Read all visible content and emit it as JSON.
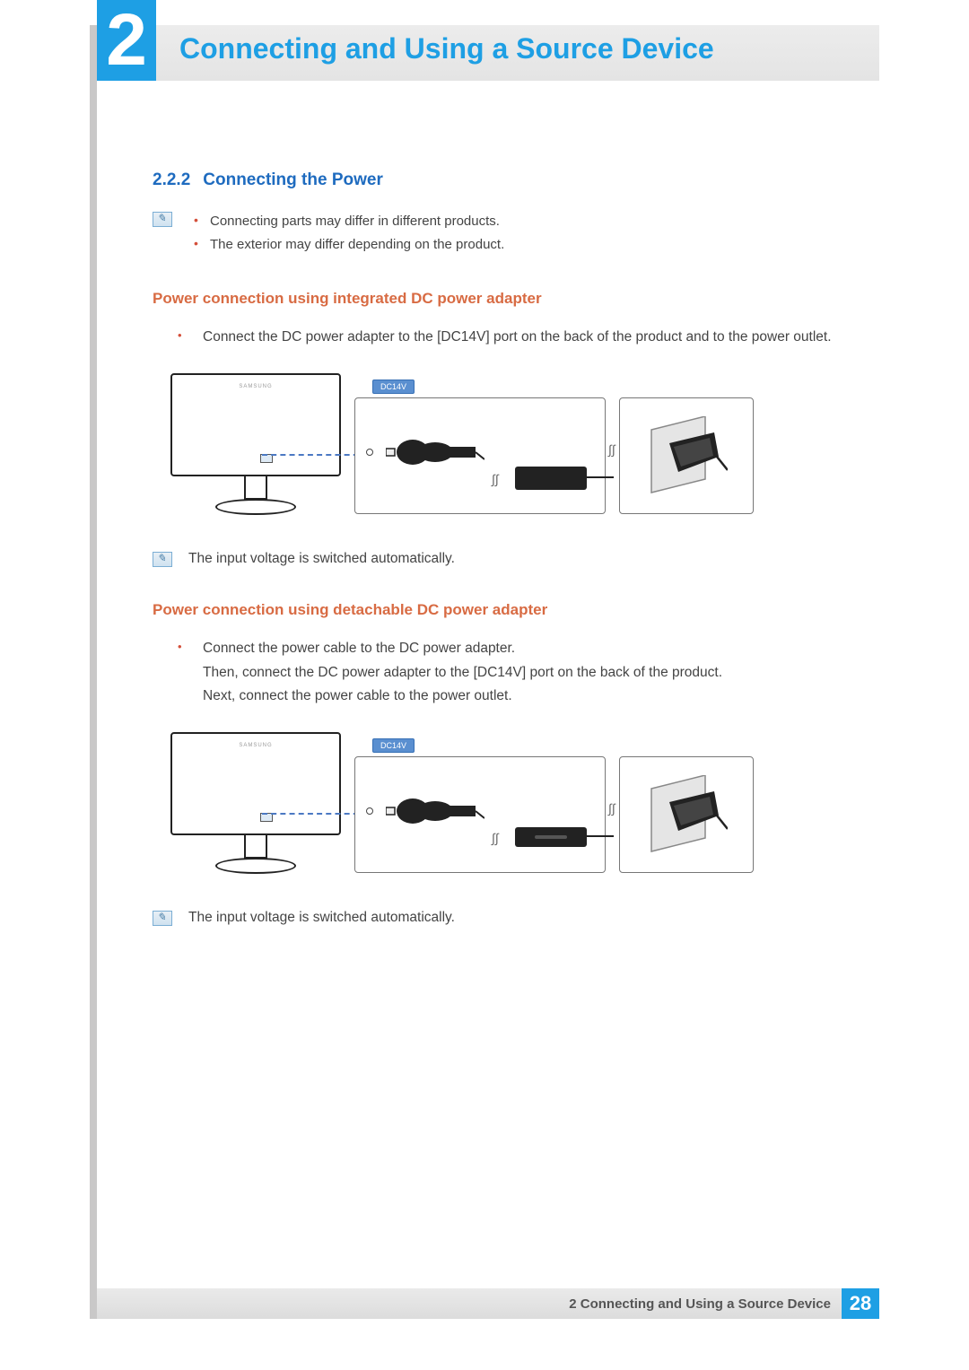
{
  "chapter": {
    "number": "2",
    "title": "Connecting and Using a Source Device"
  },
  "section": {
    "number": "2.2.2",
    "title": "Connecting the Power"
  },
  "intro_notes": [
    "Connecting parts may differ in different products.",
    "The exterior may differ depending on the product."
  ],
  "subsections": [
    {
      "heading": "Power connection using integrated DC power adapter",
      "bullets": [
        "Connect the DC power adapter to the [DC14V] port on the back of the product and to the power outlet."
      ],
      "port_label": "DC14V",
      "note_after": "The input voltage is switched automatically."
    },
    {
      "heading": "Power connection using detachable DC power adapter",
      "bullets": [
        "Connect the power cable to the DC power adapter.\nThen, connect the DC power adapter to the [DC14V] port on the back of the product.\nNext, connect the power cable to the power outlet."
      ],
      "port_label": "DC14V",
      "note_after": "The input voltage is switched automatically."
    }
  ],
  "monitor_brand": "SAMSUNG",
  "footer": {
    "text": "2 Connecting and Using a Source Device",
    "page": "28"
  }
}
